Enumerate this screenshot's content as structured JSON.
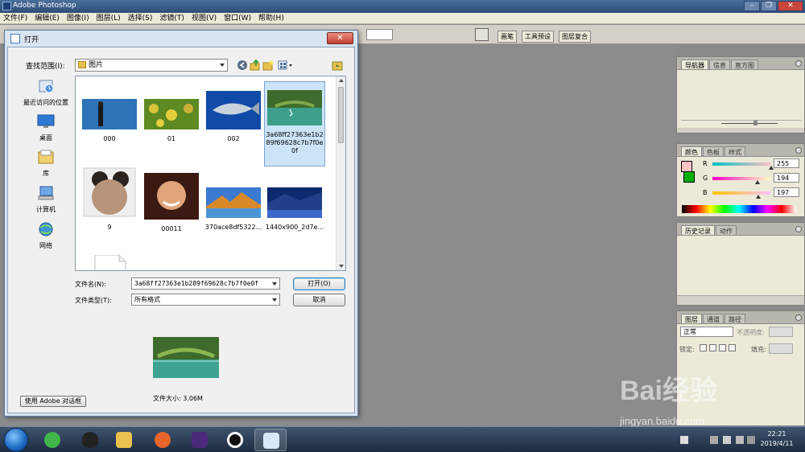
{
  "app": {
    "title": "Adobe Photoshop"
  },
  "menu": [
    "文件(F)",
    "编辑(E)",
    "图像(I)",
    "图层(L)",
    "选择(S)",
    "滤镜(T)",
    "视图(V)",
    "窗口(W)",
    "帮助(H)"
  ],
  "palette_well": {
    "tabs": [
      "画笔",
      "工具预设",
      "图层复合"
    ]
  },
  "palettes": {
    "navigator": {
      "tabs": [
        "导航器",
        "信息",
        "直方图"
      ]
    },
    "color": {
      "tabs": [
        "颜色",
        "色板",
        "样式"
      ],
      "fg_color": "#ffc2c5",
      "bg_color": "#00b000",
      "channels": [
        {
          "label": "R",
          "value": "255"
        },
        {
          "label": "G",
          "value": "194"
        },
        {
          "label": "B",
          "value": "197"
        }
      ]
    },
    "history": {
      "tabs": [
        "历史记录",
        "动作"
      ]
    },
    "layers": {
      "tabs": [
        "图层",
        "通道",
        "路径"
      ],
      "blend_mode": "正常",
      "opacity_label": "不透明度:",
      "lock_label": "锁定:",
      "fill_label": "填充:"
    }
  },
  "dialog": {
    "title": "打开",
    "close_label": "✕",
    "look_in_label": "查找范围(I):",
    "look_in_value": "图片",
    "places": [
      {
        "label": "最近访问的位置",
        "icon": "recent-places-icon"
      },
      {
        "label": "桌面",
        "icon": "desktop-icon"
      },
      {
        "label": "库",
        "icon": "library-icon"
      },
      {
        "label": "计算机",
        "icon": "computer-icon"
      },
      {
        "label": "网络",
        "icon": "network-icon"
      }
    ],
    "files": [
      {
        "name": "000"
      },
      {
        "name": "01"
      },
      {
        "name": "002"
      },
      {
        "name": "3a68ff27363e1b289f69628c7b7f0e0f",
        "selected": true
      },
      {
        "name": "9"
      },
      {
        "name": "00011"
      },
      {
        "name": "370ace8df5322..."
      },
      {
        "name": "1440x900_2d7e..."
      },
      {
        "name": ""
      }
    ],
    "filename_label": "文件名(N):",
    "filename_value": "3a68ff27363e1b289f69628c7b7f0e0f",
    "filetype_label": "文件类型(T):",
    "filetype_value": "所有格式",
    "open_button": "打开(O)",
    "cancel_button": "取消",
    "file_size": "文件大小: 3.06M",
    "adobe_dialog_button": "使用 Adobe 对话框"
  },
  "taskbar": {
    "clock_time": "22:21",
    "clock_date": "2019/4/11"
  },
  "watermark": {
    "logo": "Bai经验",
    "sub": "jingyan.baidu.com"
  }
}
